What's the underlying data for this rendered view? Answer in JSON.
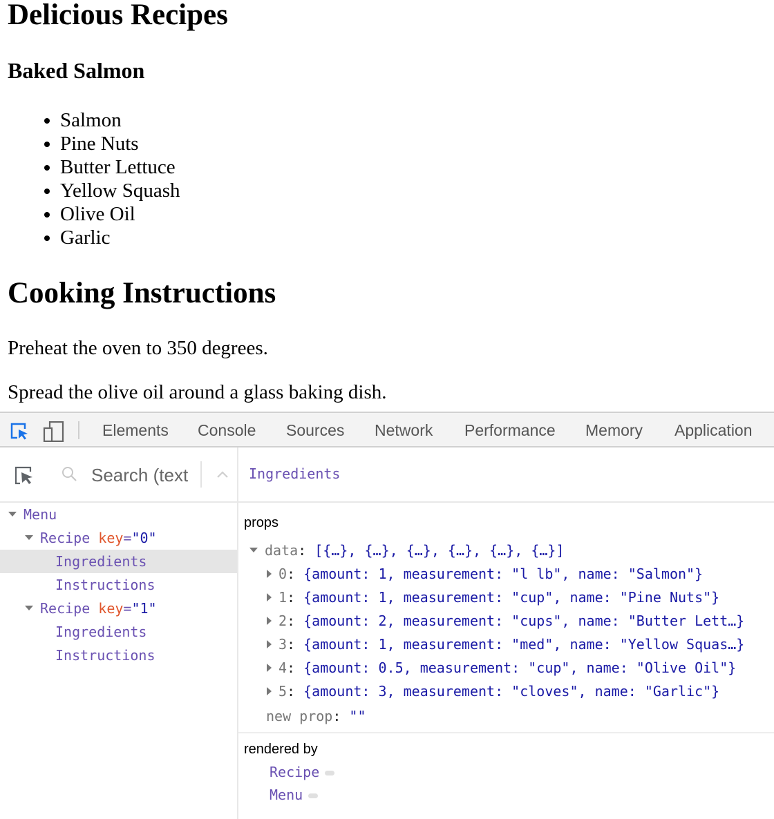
{
  "page": {
    "title": "Delicious Recipes",
    "recipe_title": "Baked Salmon",
    "ingredients": [
      "Salmon",
      "Pine Nuts",
      "Butter Lettuce",
      "Yellow Squash",
      "Olive Oil",
      "Garlic"
    ],
    "instructions_title": "Cooking Instructions",
    "steps": [
      "Preheat the oven to 350 degrees.",
      "Spread the olive oil around a glass baking dish."
    ]
  },
  "devtools": {
    "tabs": [
      "Elements",
      "Console",
      "Sources",
      "Network",
      "Performance",
      "Memory",
      "Application"
    ],
    "icons": {
      "inspect": "inspect-element-icon",
      "device": "device-toolbar-icon"
    },
    "accent_color": "#1a73e8",
    "search": {
      "placeholder": "Search (text or /regex/)",
      "visible_value": "Search (tex"
    },
    "tree": [
      {
        "label": "Menu",
        "depth": 0,
        "expanded": true
      },
      {
        "label": "Recipe",
        "depth": 1,
        "expanded": true,
        "attr_name": "key",
        "attr_value": "\"0\""
      },
      {
        "label": "Ingredients",
        "depth": 2,
        "selected": true
      },
      {
        "label": "Instructions",
        "depth": 2
      },
      {
        "label": "Recipe",
        "depth": 1,
        "expanded": true,
        "attr_name": "key",
        "attr_value": "\"1\""
      },
      {
        "label": "Ingredients",
        "depth": 2
      },
      {
        "label": "Instructions",
        "depth": 2
      }
    ],
    "selected_component": "Ingredients",
    "props_label": "props",
    "data_key": "data",
    "data_summary": "[{…}, {…}, {…}, {…}, {…}, {…}]",
    "items": [
      {
        "index": "0",
        "value": "{amount: 1, measurement: \"l lb\", name: \"Salmon\"}"
      },
      {
        "index": "1",
        "value": "{amount: 1, measurement: \"cup\", name: \"Pine Nuts\"}"
      },
      {
        "index": "2",
        "value": "{amount: 2, measurement: \"cups\", name: \"Butter Lett…}"
      },
      {
        "index": "3",
        "value": "{amount: 1, measurement: \"med\", name: \"Yellow Squas…}"
      },
      {
        "index": "4",
        "value": "{amount: 0.5, measurement: \"cup\", name: \"Olive Oil\"}"
      },
      {
        "index": "5",
        "value": "{amount: 3, measurement: \"cloves\", name: \"Garlic\"}"
      }
    ],
    "new_prop": {
      "key": "new prop",
      "value": "\"\""
    },
    "rendered_by_label": "rendered by",
    "rendered_by": [
      "Recipe",
      "Menu"
    ]
  }
}
